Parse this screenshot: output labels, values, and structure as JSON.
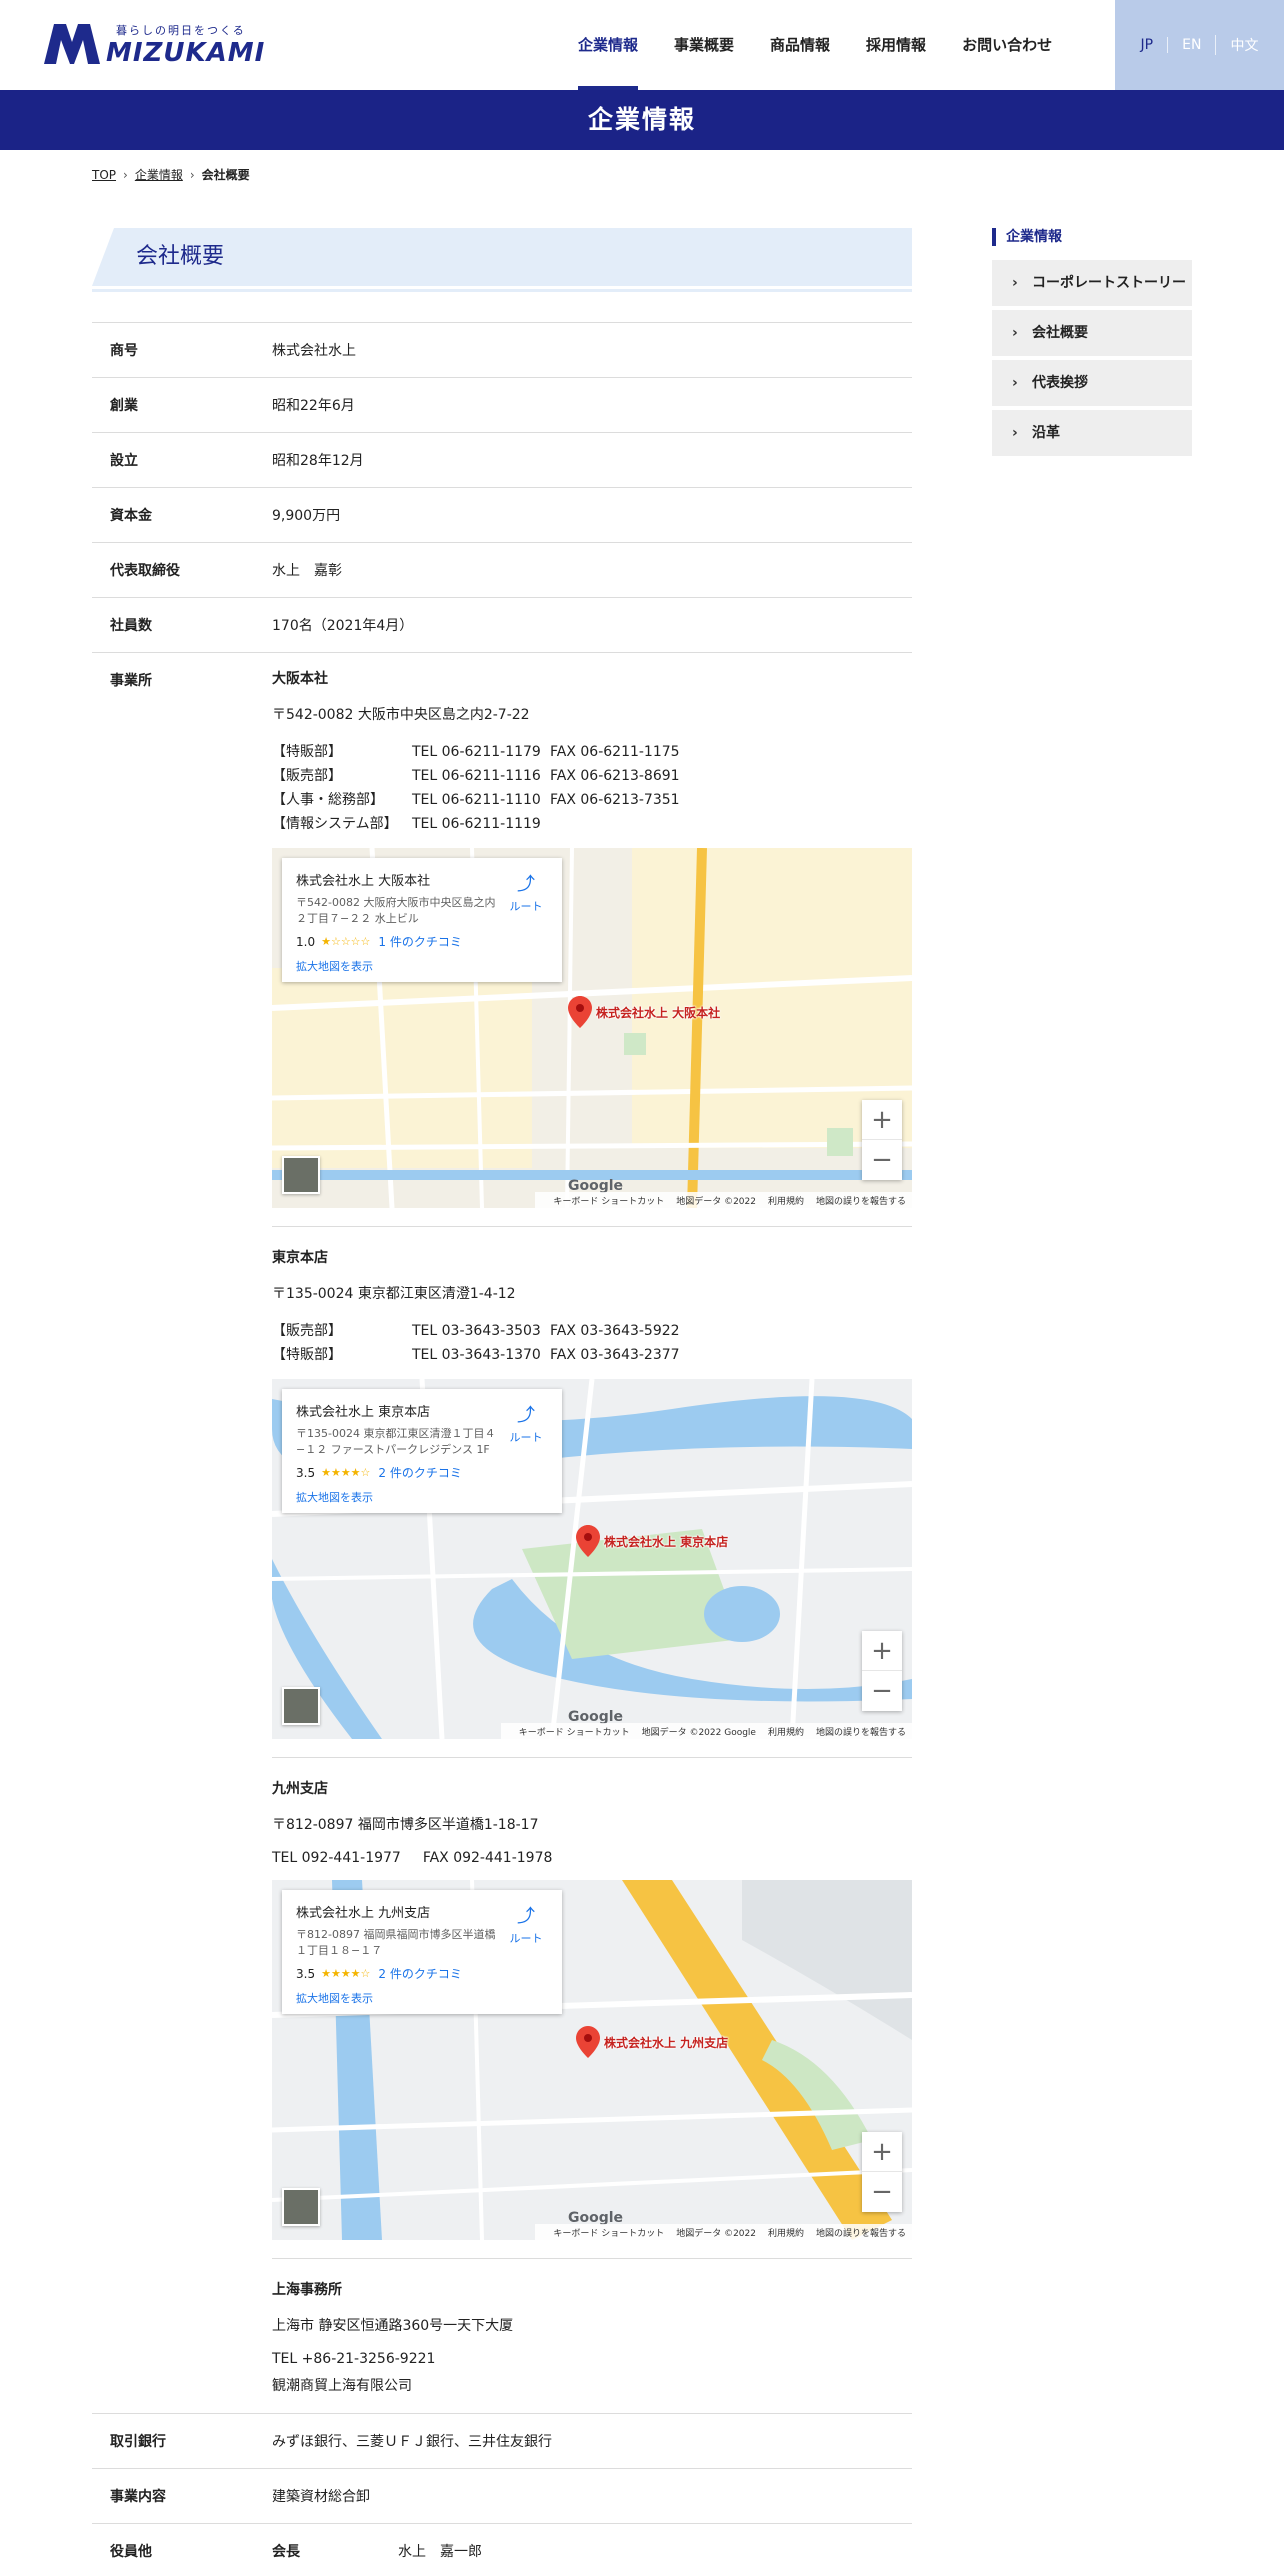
{
  "header": {
    "logo_tagline": "暮らしの明日をつくる",
    "logo_text": "MIZUKAMI",
    "nav": [
      "企業情報",
      "事業概要",
      "商品情報",
      "採用情報",
      "お問い合わせ"
    ],
    "nav_active_index": 0,
    "languages": [
      "JP",
      "EN",
      "中文"
    ],
    "language_active_index": 0
  },
  "banner": {
    "title": "企業情報"
  },
  "breadcrumb": {
    "items": [
      "TOP",
      "企業情報",
      "会社概要"
    ]
  },
  "section": {
    "title": "会社概要"
  },
  "rows": [
    {
      "label": "商号",
      "value": "株式会社水上"
    },
    {
      "label": "創業",
      "value": "昭和22年6月"
    },
    {
      "label": "設立",
      "value": "昭和28年12月"
    },
    {
      "label": "資本金",
      "value": "9,900万円"
    },
    {
      "label": "代表取締役",
      "value": "水上　嘉彰"
    },
    {
      "label": "社員数",
      "value": "170名（2021年4月）"
    }
  ],
  "offices_label": "事業所",
  "osaka": {
    "name": "大阪本社",
    "address": "〒542-0082 大阪市中央区島之内2-7-22",
    "contacts": [
      {
        "dept": "【特販部】",
        "tel": "TEL 06-6211-1179",
        "fax": "FAX 06-6211-1175"
      },
      {
        "dept": "【販売部】",
        "tel": "TEL 06-6211-1116",
        "fax": "FAX 06-6213-8691"
      },
      {
        "dept": "【人事・総務部】",
        "tel": "TEL 06-6211-1110",
        "fax": "FAX 06-6213-7351"
      },
      {
        "dept": "【情報システム部】",
        "tel": "TEL 06-6211-1119",
        "fax": ""
      }
    ],
    "map": {
      "title": "株式会社水上 大阪本社",
      "address": "〒542-0082 大阪府大阪市中央区島之内２丁目７−２２ 水上ビル",
      "rating": "1.0",
      "stars": "★☆☆☆☆",
      "reviews": "1 件のクチコミ",
      "larger": "拡大地図を表示",
      "route": "ルート",
      "pin_label": "株式会社水上 大阪本社"
    }
  },
  "tokyo": {
    "name": "東京本店",
    "address": "〒135-0024 東京都江東区清澄1-4-12",
    "contacts": [
      {
        "dept": "【販売部】",
        "tel": "TEL 03-3643-3503",
        "fax": "FAX 03-3643-5922"
      },
      {
        "dept": "【特販部】",
        "tel": "TEL 03-3643-1370",
        "fax": "FAX 03-3643-2377"
      }
    ],
    "map": {
      "title": "株式会社水上 東京本店",
      "address": "〒135-0024 東京都江東区清澄１丁目４−１２ ファーストパークレジデンス 1F",
      "rating": "3.5",
      "stars": "★★★★☆",
      "reviews": "2 件のクチコミ",
      "larger": "拡大地図を表示",
      "route": "ルート",
      "pin_label": "株式会社水上 東京本店"
    }
  },
  "kyushu": {
    "name": "九州支店",
    "address": "〒812-0897 福岡市博多区半道橋1-18-17",
    "tel": "TEL 092-441-1977",
    "fax": "FAX 092-441-1978",
    "map": {
      "title": "株式会社水上 九州支店",
      "address": "〒812-0897 福岡県福岡市博多区半道橋１丁目１８−１７",
      "rating": "3.5",
      "stars": "★★★★☆",
      "reviews": "2 件のクチコミ",
      "larger": "拡大地図を表示",
      "route": "ルート",
      "pin_label": "株式会社水上 九州支店"
    }
  },
  "shanghai": {
    "name": "上海事務所",
    "address": "上海市 静安区恒通路360号一天下大厦",
    "tel": "TEL +86-21-3256-9221",
    "company": "観潮商貿上海有限公司"
  },
  "map_footer": {
    "google": "Google",
    "shortcuts": "キーボード ショートカット",
    "mapdata": "地図データ ©2022",
    "mapdata_google": "地図データ ©2022 Google",
    "terms": "利用規約",
    "report": "地図の誤りを報告する"
  },
  "rows_bottom": [
    {
      "label": "取引銀行",
      "value": "みずほ銀行、三菱ＵＦＪ銀行、三井住友銀行"
    },
    {
      "label": "事業内容",
      "value": "建築資材総合卸"
    }
  ],
  "officers": {
    "label": "役員他",
    "role": "会長",
    "name": "水上　嘉一郎"
  },
  "sidebar": {
    "title": "企業情報",
    "items": [
      "コーポレートストーリー",
      "会社概要",
      "代表挨拶",
      "沿革"
    ]
  }
}
